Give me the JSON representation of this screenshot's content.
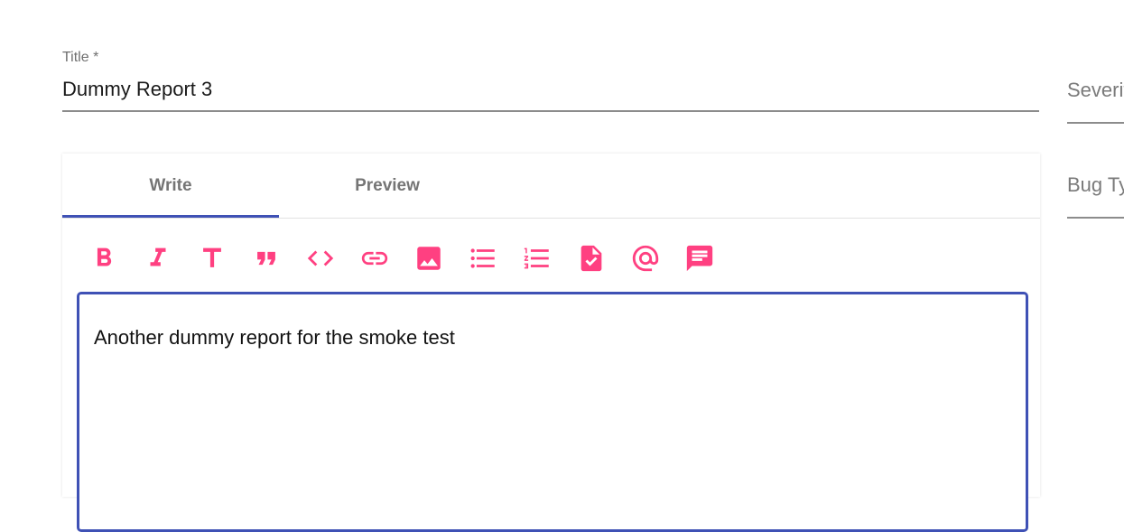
{
  "title_field": {
    "label": "Title *",
    "value": "Dummy Report 3"
  },
  "side_fields": [
    {
      "label": "Severity"
    },
    {
      "label": "Bug Type"
    }
  ],
  "editor": {
    "tabs": [
      {
        "label": "Write",
        "active": true
      },
      {
        "label": "Preview",
        "active": false
      }
    ],
    "toolbar_icons": [
      "bold-icon",
      "italic-icon",
      "header-icon",
      "quote-icon",
      "code-icon",
      "link-icon",
      "image-icon",
      "bulleted-list-icon",
      "numbered-list-icon",
      "file-check-icon",
      "mention-icon",
      "comment-icon"
    ],
    "body_text": "Another dummy report for the smoke test"
  },
  "colors": {
    "accent": "#3f51b5",
    "icon": "#ff4081",
    "tab_text": "#757575",
    "underline": "#8c8c8c"
  }
}
